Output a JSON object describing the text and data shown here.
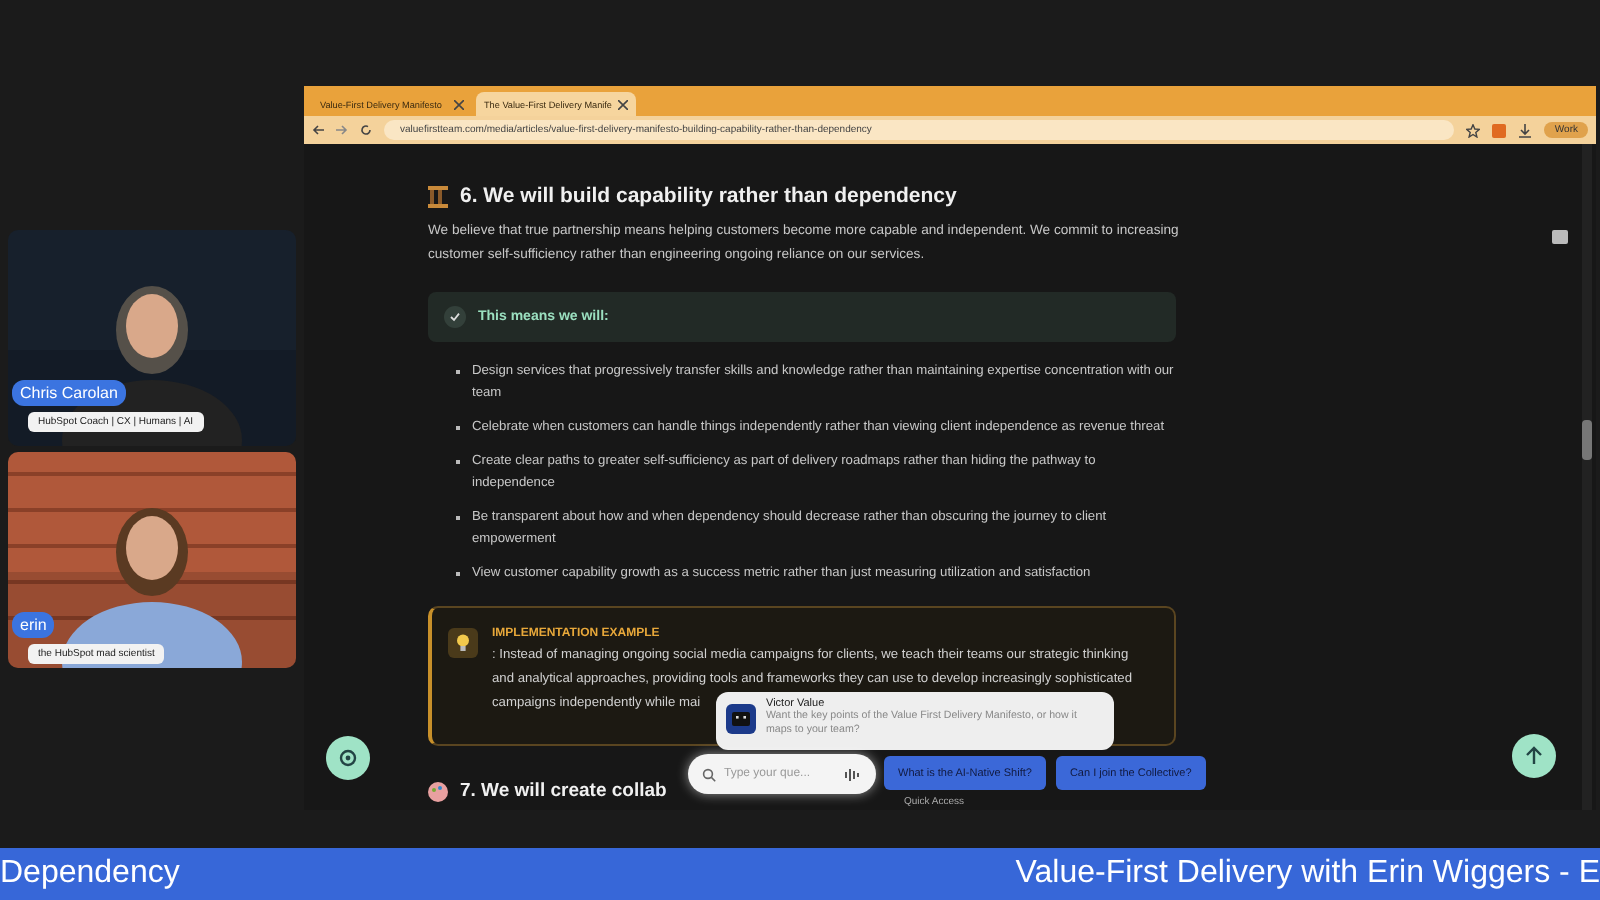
{
  "participants": [
    {
      "name": "Chris Carolan",
      "subtitle": "HubSpot Coach | CX | Humans | AI"
    },
    {
      "name": "erin",
      "subtitle": "the HubSpot mad scientist"
    }
  ],
  "browser": {
    "tabs": [
      {
        "label": "Value-First Delivery Manifesto",
        "selected": false
      },
      {
        "label": "The Value-First Delivery Manife",
        "selected": true
      }
    ],
    "url": "valuefirstteam.com/media/articles/value-first-delivery-manifesto-building-capability-rather-than-dependency",
    "profile": "Work"
  },
  "article": {
    "heading": "6. We will build capability rather than dependency",
    "intro": "We believe that true partnership means helping customers become more capable and independent. We commit to increasing customer self-sufficiency rather than engineering ongoing reliance on our services.",
    "callout": "This means we will:",
    "bullets": [
      "Design services that progressively transfer skills and knowledge rather than maintaining expertise concentration with our team",
      "Celebrate when customers can handle things independently rather than viewing client independence as revenue threat",
      "Create clear paths to greater self-sufficiency as part of delivery roadmaps rather than hiding the pathway to independence",
      "Be transparent about how and when dependency should decrease rather than obscuring the journey to client empowerment",
      "View customer capability growth as a success metric rather than just measuring utilization and satisfaction"
    ],
    "example": {
      "title": "IMPLEMENTATION EXAMPLE",
      "lines": [
        ": Instead of managing ongoing social media campaigns for clients, we teach their teams our strategic thinking",
        "and analytical approaches, providing tools and frameworks they can use to develop increasingly sophisticated",
        "campaigns independently while mai"
      ]
    },
    "next_heading": "7. We will create collab"
  },
  "assistant": {
    "name": "Victor Value",
    "message": "Want the key points of the Value First Delivery Manifesto, or how it maps to your team?",
    "input_placeholder": "Type your que...",
    "suggestions": [
      "What is the AI-Native Shift?",
      "Can I join the Collective?"
    ],
    "footer": "Quick Access"
  },
  "ticker": {
    "left": "Dependency",
    "right": "Value-First Delivery with Erin Wiggers - E"
  }
}
